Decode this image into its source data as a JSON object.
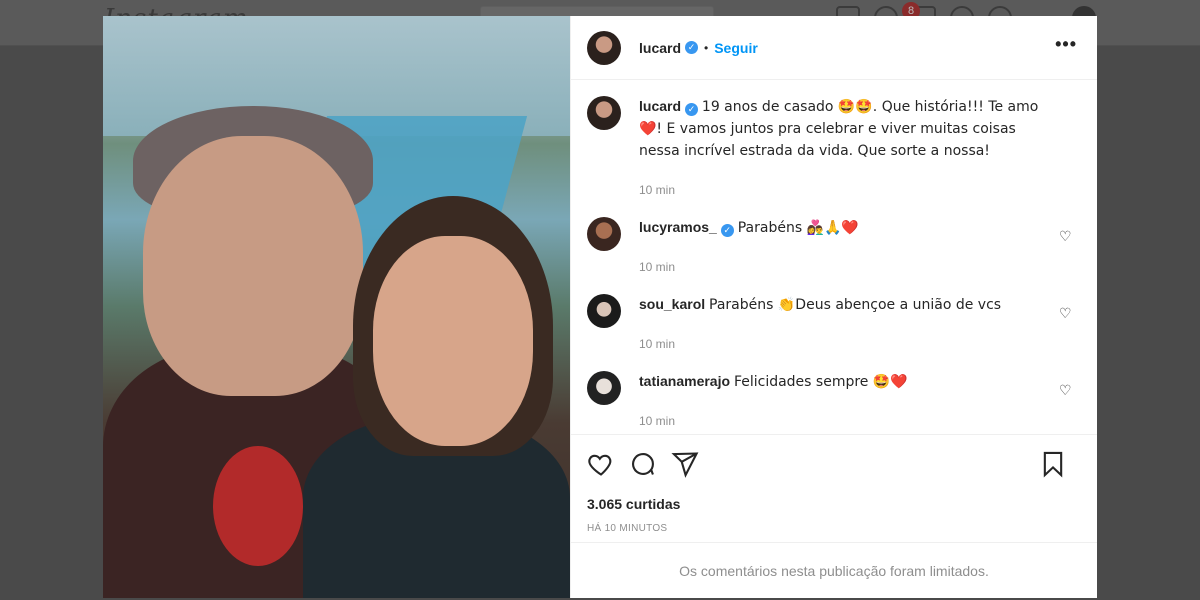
{
  "topbar": {
    "logo": "Instagram",
    "notification_count": "8"
  },
  "post": {
    "author": "lucard",
    "follow_label": "Seguir",
    "separator": "•",
    "more_label": "•••",
    "caption": {
      "username": "lucard",
      "text": "19 anos de casado 🤩🤩. Que história!!! Te amo ❤️! E vamos juntos pra celebrar e viver muitas coisas nessa incrível estrada da vida. Que sorte a nossa!",
      "time": "10 min"
    },
    "comments": [
      {
        "username": "lucyramos_",
        "verified": true,
        "text": "Parabéns 👩‍❤️‍👨🙏❤️",
        "time": "10 min"
      },
      {
        "username": "sou_karol",
        "verified": false,
        "text": "Parabéns 👏Deus abençoe a união de vcs",
        "time": "10 min"
      },
      {
        "username": "tatianamerajo",
        "verified": false,
        "text": "Felicidades sempre 🤩❤️",
        "time": "10 min"
      }
    ],
    "likes": "3.065 curtidas",
    "posted_ago": "HÁ 10 MINUTOS",
    "comments_limited": "Os comentários nesta publicação foram limitados."
  },
  "icons": {
    "verified": "verified-badge-icon",
    "like": "heart-icon",
    "comment": "comment-icon",
    "share": "paper-plane-icon",
    "save": "bookmark-icon",
    "more": "more-options-icon"
  },
  "colors": {
    "link": "#0095f6",
    "verified": "#3897f0",
    "muted": "#8e8e8e",
    "text": "#262626"
  }
}
